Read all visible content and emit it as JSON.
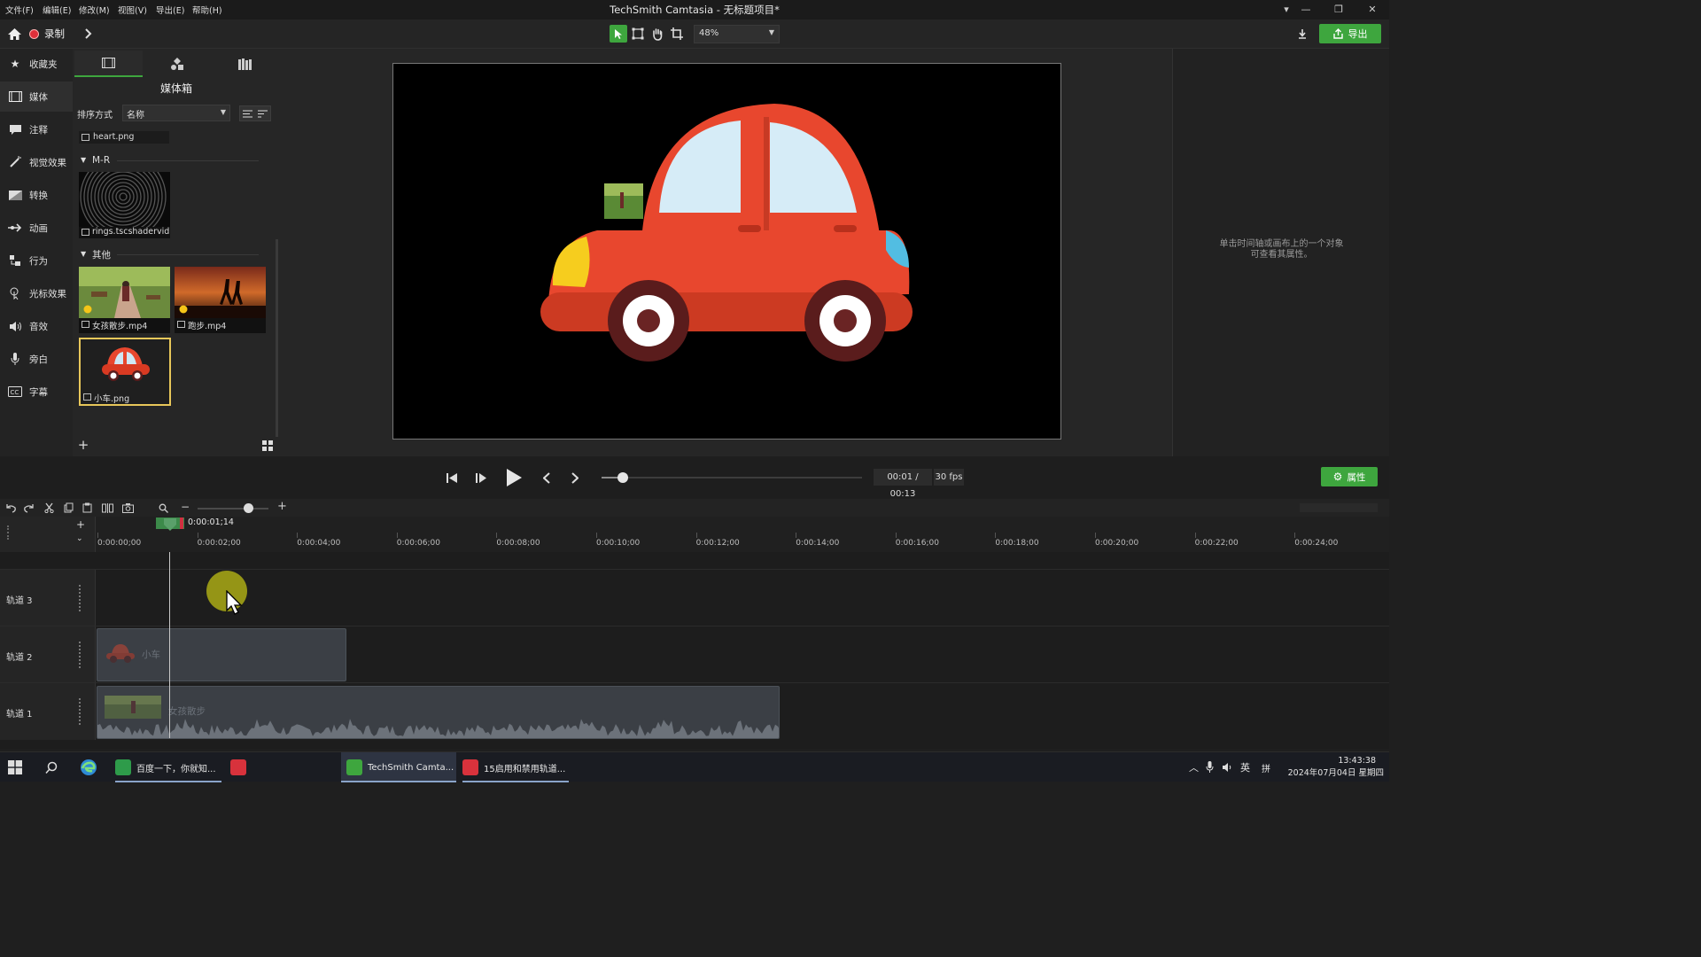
{
  "app": {
    "title": "TechSmith Camtasia - 无标题项目*"
  },
  "menu": [
    "文件(F)",
    "编辑(E)",
    "修改(M)",
    "视图(V)",
    "导出(E)",
    "帮助(H)"
  ],
  "toolbar": {
    "record_label": "录制",
    "zoom": "48%",
    "export_label": "导出"
  },
  "nav": [
    {
      "label": "收藏夹",
      "icon": "star-icon"
    },
    {
      "label": "媒体",
      "icon": "film-icon"
    },
    {
      "label": "注释",
      "icon": "annotation-icon"
    },
    {
      "label": "视觉效果",
      "icon": "wand-icon"
    },
    {
      "label": "转换",
      "icon": "transition-icon"
    },
    {
      "label": "动画",
      "icon": "arrow-icon"
    },
    {
      "label": "行为",
      "icon": "behavior-icon"
    },
    {
      "label": "光标效果",
      "icon": "cursor-icon"
    },
    {
      "label": "音效",
      "icon": "speaker-icon"
    },
    {
      "label": "旁白",
      "icon": "mic-icon"
    },
    {
      "label": "字幕",
      "icon": "cc-icon"
    }
  ],
  "media_bin": {
    "title": "媒体箱",
    "sort_label": "排序方式",
    "sort_value": "名称",
    "items_top": [
      "heart.png"
    ],
    "section_mr": "M-R",
    "section_other": "其他",
    "items_mr": [
      "rings.tscshadervid"
    ],
    "items_other": [
      "女孩散步.mp4",
      "跑步.mp4",
      "小车.png"
    ]
  },
  "properties": {
    "hint_line1": "单击时间轴或画布上的一个对象",
    "hint_line2": "可查看其属性。",
    "button": "属性"
  },
  "playback": {
    "time": "00:01 / 00:13",
    "fps": "30 fps",
    "progress": 0.08
  },
  "timeline": {
    "playhead": "0:00:01;14",
    "ticks": [
      "0:00:00;00",
      "0:00:02;00",
      "0:00:04;00",
      "0:00:06;00",
      "0:00:08;00",
      "0:00:10;00",
      "0:00:12;00",
      "0:00:14;00",
      "0:00:16;00",
      "0:00:18;00",
      "0:00:20;00",
      "0:00:22;00",
      "0:00:24;00"
    ],
    "tracks": [
      {
        "label": "轨道 3",
        "clip": ""
      },
      {
        "label": "轨道 2",
        "clip": "小车"
      },
      {
        "label": "轨道 1",
        "clip": "女孩散步"
      }
    ]
  },
  "taskbar": {
    "apps": [
      "百度一下，你就知...",
      "TechSmith Camta...",
      "15启用和禁用轨道..."
    ],
    "ime": "英",
    "ime2": "拼",
    "time": "13:43:38",
    "date": "2024年07月04日 星期四"
  },
  "colors": {
    "accent": "#3ea63e",
    "record": "#e0303a",
    "car_body": "#e8472e"
  }
}
